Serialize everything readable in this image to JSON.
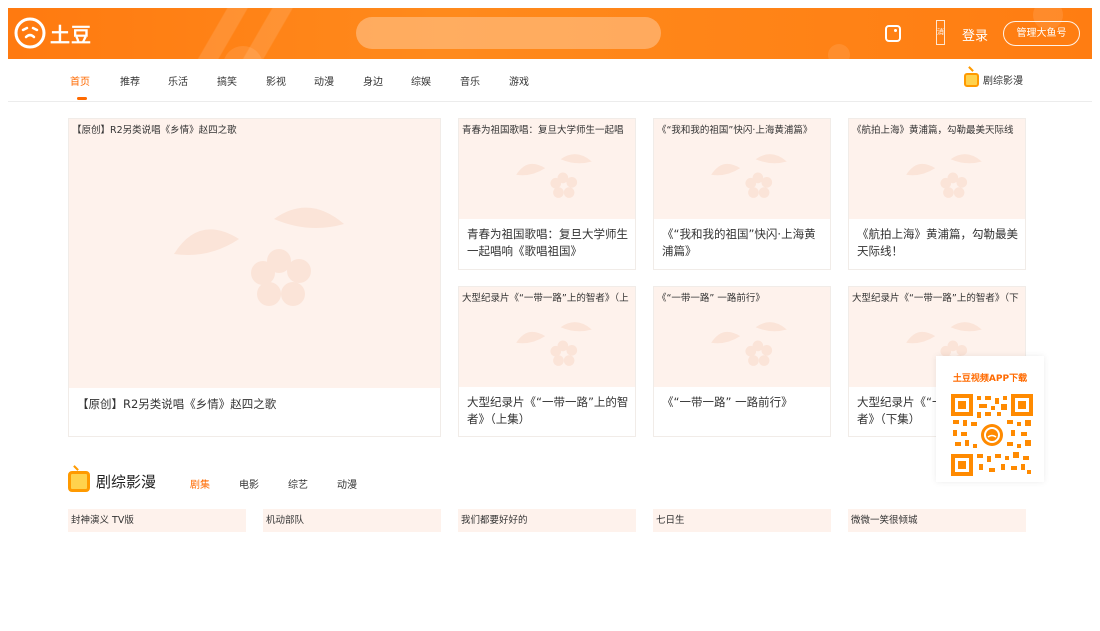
{
  "header": {
    "logo_text": "土豆",
    "search_placeholder": "",
    "msg_icon_char": "消",
    "login_label": "登录",
    "manage_label": "管理大鱼号",
    "brand_color": "#ff7a10"
  },
  "nav": {
    "items": [
      {
        "label": "首页",
        "active": true
      },
      {
        "label": "推荐"
      },
      {
        "label": "乐活"
      },
      {
        "label": "搞笑"
      },
      {
        "label": "影视"
      },
      {
        "label": "动漫"
      },
      {
        "label": "身边"
      },
      {
        "label": "综娱"
      },
      {
        "label": "音乐"
      },
      {
        "label": "游戏"
      }
    ],
    "right_label": "剧综影漫"
  },
  "featured": {
    "thumb_title": "【原创】R2另类说唱《乡情》赵四之歌",
    "caption": "【原创】R2另类说唱《乡情》赵四之歌"
  },
  "cards": [
    {
      "thumb_title": "青春为祖国歌唱：复旦大学师生一起唱",
      "caption": "青春为祖国歌唱：复旦大学师生一起唱响《歌唱祖国》"
    },
    {
      "thumb_title": "《“我和我的祖国”快闪·上海黄浦篇》",
      "caption": "《“我和我的祖国”快闪·上海黄浦篇》"
    },
    {
      "thumb_title": "《航拍上海》黄浦篇，勾勒最美天际线",
      "caption": "《航拍上海》黄浦篇，勾勒最美天际线！"
    },
    {
      "thumb_title": "大型纪录片《“一带一路”上的智者》（上",
      "caption": "大型纪录片《“一带一路”上的智者》（上集）"
    },
    {
      "thumb_title": "《“一带一路” 一路前行》",
      "caption": "《“一带一路” 一路前行》"
    },
    {
      "thumb_title": "大型纪录片《“一带一路”上的智者》（下",
      "caption": "大型纪录片《“一带一路”上的智者》（下集）"
    }
  ],
  "section2": {
    "title": "剧综影漫",
    "tabs": [
      {
        "label": "剧集",
        "active": true
      },
      {
        "label": "电影"
      },
      {
        "label": "综艺"
      },
      {
        "label": "动漫"
      }
    ],
    "items": [
      "封神演义 TV版",
      "机动部队",
      "我们都要好好的",
      "七日生",
      "微微一笑很倾城"
    ]
  },
  "qr": {
    "title": "土豆视频APP下载"
  },
  "colors": {
    "accent": "#ff6a00",
    "thumb_bg": "#fef2ec"
  }
}
